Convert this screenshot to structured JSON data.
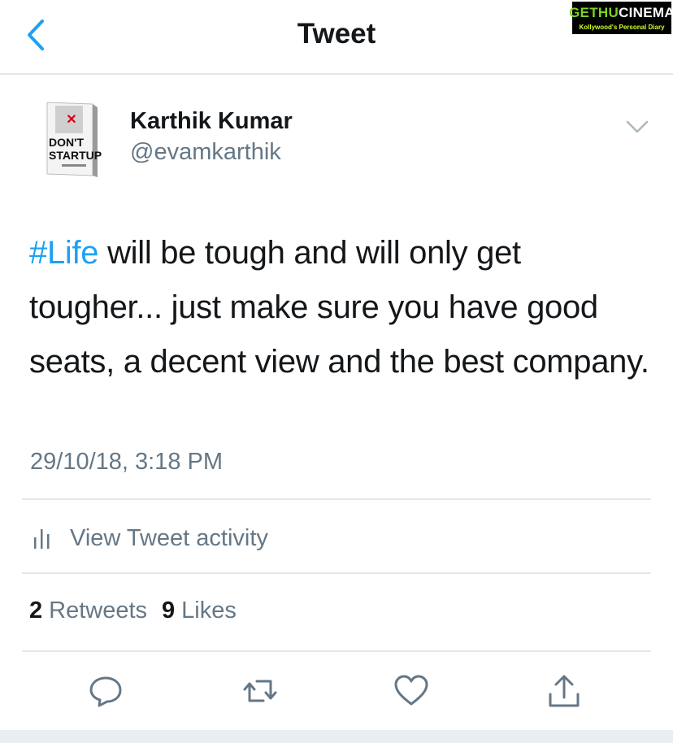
{
  "header": {
    "title": "Tweet",
    "back_icon": "chevron-left-icon"
  },
  "watermark": {
    "brand_left": "GETHU",
    "brand_right": "CINEMA",
    "tagline": "Kollywood's Personal Diary"
  },
  "tweet": {
    "author_name": "Karthik Kumar",
    "author_handle": "@evamkarthik",
    "avatar_book_line1": "DON'T",
    "avatar_book_line2": "STARTUP",
    "hashtag": "#Life",
    "body": " will be tough and will only get tougher... just make sure you have good seats, a decent view and the best company.",
    "timestamp": "29/10/18, 3:18 PM"
  },
  "activity": {
    "label": "View Tweet activity",
    "icon": "bar-chart-icon"
  },
  "stats": {
    "retweets_count": "2",
    "retweets_label": "Retweets",
    "likes_count": "9",
    "likes_label": "Likes"
  },
  "actions": [
    "reply-icon",
    "retweet-icon",
    "like-icon",
    "share-icon"
  ],
  "colors": {
    "accent": "#1da1f2",
    "text": "#14171a",
    "muted": "#657786",
    "divider": "#e1e8ed"
  }
}
